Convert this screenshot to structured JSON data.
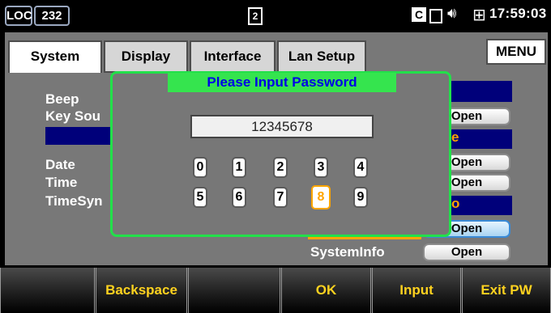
{
  "status_bar": {
    "mode_badge": "LOC",
    "channel_badge": "232",
    "page_icon_label": "2",
    "ce_label": "C",
    "time": "17:59:03",
    "icons": [
      "document-icon",
      "ce-icon",
      "usb-icon",
      "speaker-icon",
      "lan-icon"
    ]
  },
  "tabs": [
    {
      "label": "System",
      "active": true
    },
    {
      "label": "Display",
      "active": false
    },
    {
      "label": "Interface",
      "active": false
    },
    {
      "label": "Lan Setup",
      "active": false
    }
  ],
  "menu_button": "MENU",
  "settings_rows": {
    "beep": "Beep",
    "key_sound": "Key Sou",
    "date": "Date",
    "time": "Time",
    "time_sync": "TimeSyn",
    "system_info": "SystemInfo"
  },
  "open_buttons": [
    "Open",
    "Open",
    "Open",
    "Open",
    "Open"
  ],
  "partial_orange_1": "e",
  "partial_orange_2": "o",
  "dialog": {
    "title": "Please Input Password",
    "password_value": "12345678",
    "keys": [
      "0",
      "1",
      "2",
      "3",
      "4",
      "5",
      "6",
      "7",
      "8",
      "9"
    ],
    "selected_key": "8"
  },
  "soft_keys": [
    "",
    "Backspace",
    "",
    "OK",
    "Input",
    "Exit PW"
  ],
  "colors": {
    "dialog_border": "#22e04a",
    "title_text": "#0000e6",
    "soft_key_text": "#ffd21f",
    "highlight": "#ffa500",
    "navy_bar": "#00007a"
  }
}
